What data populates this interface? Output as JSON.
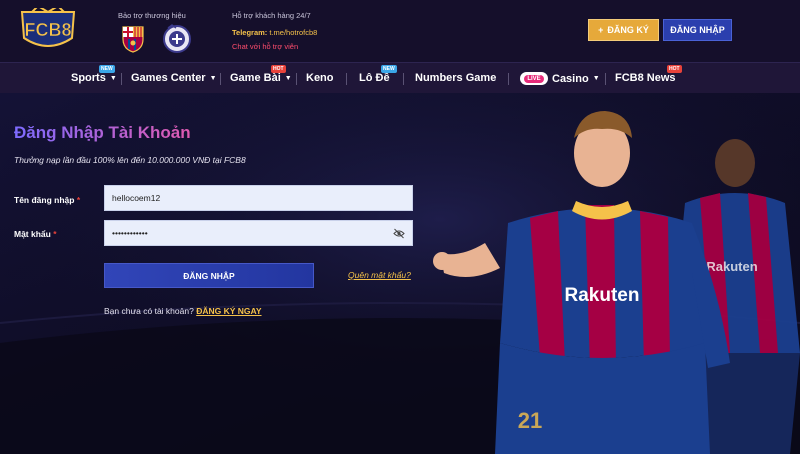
{
  "header": {
    "logo_text": "FCB8",
    "sponsor_label": "Bảo trợ thương hiệu",
    "support_label": "Hỗ trợ khách hàng 24/7",
    "telegram_key": "Telegram:",
    "telegram_value": "t.me/hotrofcb8",
    "chat_label": "Chat với hỗ trợ viên",
    "register_button": "ĐĂNG KÝ",
    "login_button": "ĐĂNG NHẬP"
  },
  "nav": {
    "items": [
      {
        "label": "Sports",
        "tag": "NEW",
        "dropdown": true
      },
      {
        "label": "Games Center",
        "dropdown": true
      },
      {
        "label": "Game Bài",
        "tag": "HOT",
        "dropdown": true
      },
      {
        "label": "Keno"
      },
      {
        "label": "Lô Đề",
        "tag": "NEW"
      },
      {
        "label": "Numbers Game"
      },
      {
        "label": "Casino",
        "live": "LIVE",
        "dropdown": true
      },
      {
        "label": "FCB8 News",
        "tag": "HOT"
      }
    ]
  },
  "login": {
    "title": "Đăng Nhập Tài Khoản",
    "promo": "Thưởng nạp lần đầu 100% lên đến 10.000.000 VNĐ tại FCB8",
    "username_label": "Tên đăng nhập",
    "username_value": "hellocoem12",
    "password_label": "Mật khẩu",
    "password_value": "••••••••••••",
    "required_mark": "*",
    "submit": "ĐĂNG NHẬP",
    "forgot": "Quên mật khẩu?",
    "no_account": "Bạn chưa có tài khoản?",
    "register_now": "ĐĂNG KÝ NGAY"
  },
  "players": {
    "jersey_text": "Rakuten",
    "front_number": "21"
  },
  "colors": {
    "accent_gold": "#f5c24a",
    "accent_blue": "#2b3fae",
    "hot_red": "#e8423a",
    "new_blue": "#3aa6e8"
  }
}
